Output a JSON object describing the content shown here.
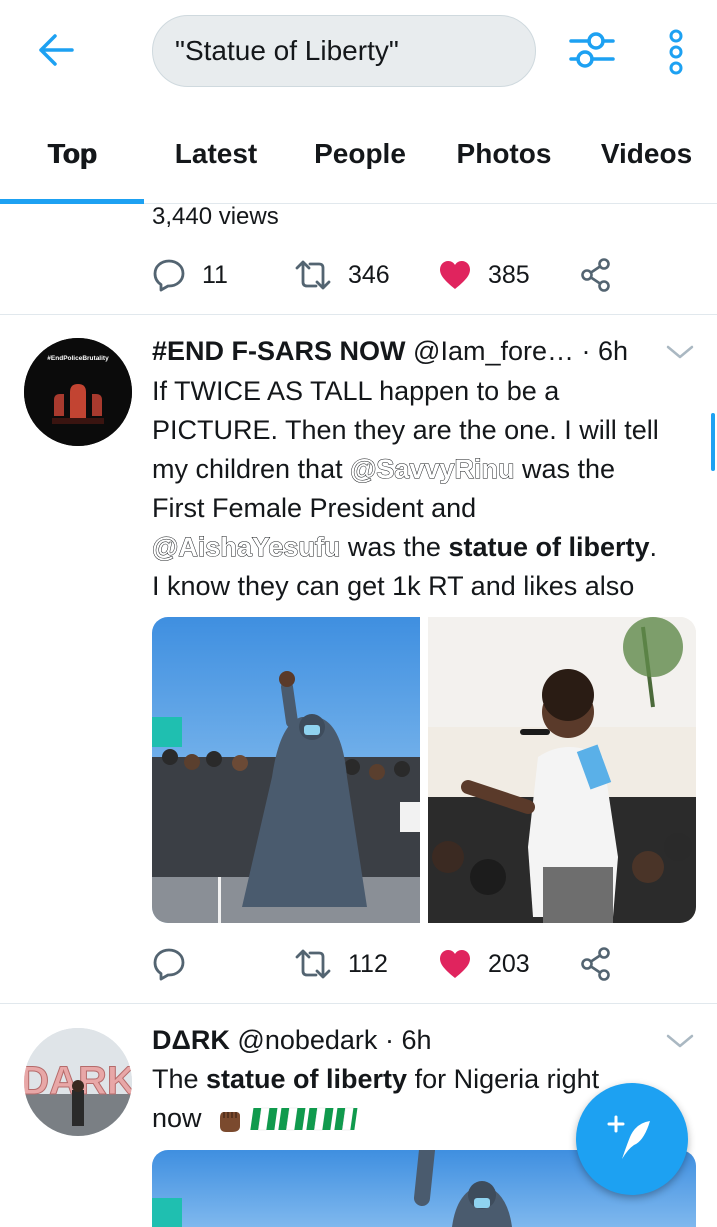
{
  "search": {
    "query": "\"Statue of Liberty\""
  },
  "tabs": [
    {
      "label": "Top"
    },
    {
      "label": "Latest"
    },
    {
      "label": "People"
    },
    {
      "label": "Photos"
    },
    {
      "label": "Videos"
    }
  ],
  "active_tab": "Top",
  "prev_tweet": {
    "views": "3,440 views",
    "replies": "11",
    "retweets": "346",
    "likes": "385"
  },
  "tweet1": {
    "display_name": "#END F-SARS NOW",
    "handle": "@Iam_fore…",
    "dot": "·",
    "time": "6h",
    "avatar_text": "#EndPoliceBrutality",
    "text_parts": {
      "l1": "If TWICE AS TALL happen to be a",
      "l2": "PICTURE. Then they are the one. I will tell",
      "l3a": "my children that ",
      "mention1": "@SavvyRinu",
      "l3b": "  was the",
      "l4": "First Female President and",
      "mention2": "@AishaYesufu",
      "l5a": "  was the ",
      "l5bold": "statue of liberty",
      "l5b": ".",
      "l6": "I know they can get 1k RT and likes also"
    },
    "replies": "",
    "retweets": "112",
    "likes": "203"
  },
  "tweet2": {
    "display_name": "DΔRK",
    "handle": "@nobedark",
    "dot": "·",
    "time": "6h",
    "avatar_text": "DARK",
    "text_a": "The ",
    "text_bold": "statue of liberty",
    "text_b": " for Nigeria right",
    "text_line2": "now"
  },
  "colors": {
    "accent": "#1da1f2",
    "like": "#e0245e",
    "text": "#14171a",
    "divider": "#e1e8ed",
    "search_bg": "#e8ecee"
  },
  "icons": [
    "back-arrow-icon",
    "filter-sliders-icon",
    "more-vertical-icon",
    "reply-icon",
    "retweet-icon",
    "heart-icon",
    "share-icon",
    "chevron-down-icon",
    "compose-feather-icon"
  ]
}
